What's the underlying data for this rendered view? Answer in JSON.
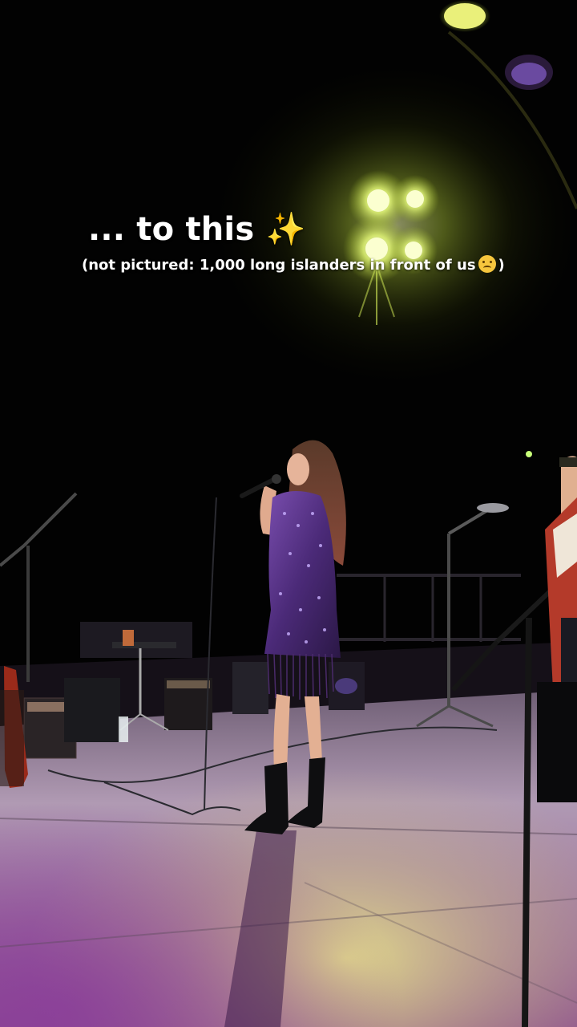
{
  "caption": {
    "line1": "... to this",
    "line1_emoji": "✨",
    "line2_prefix": "(not pictured: 1,000 long islanders in front of us",
    "line2_emoji": "face-holding-back-tears",
    "line2_suffix": ")"
  },
  "colors": {
    "stage_floor_light": "#c7c08a",
    "stage_floor_purple": "#7b3a86",
    "spotlight_yellow": "#eaff7a",
    "dress_purple": "#5a2e86",
    "background": "#020202"
  }
}
